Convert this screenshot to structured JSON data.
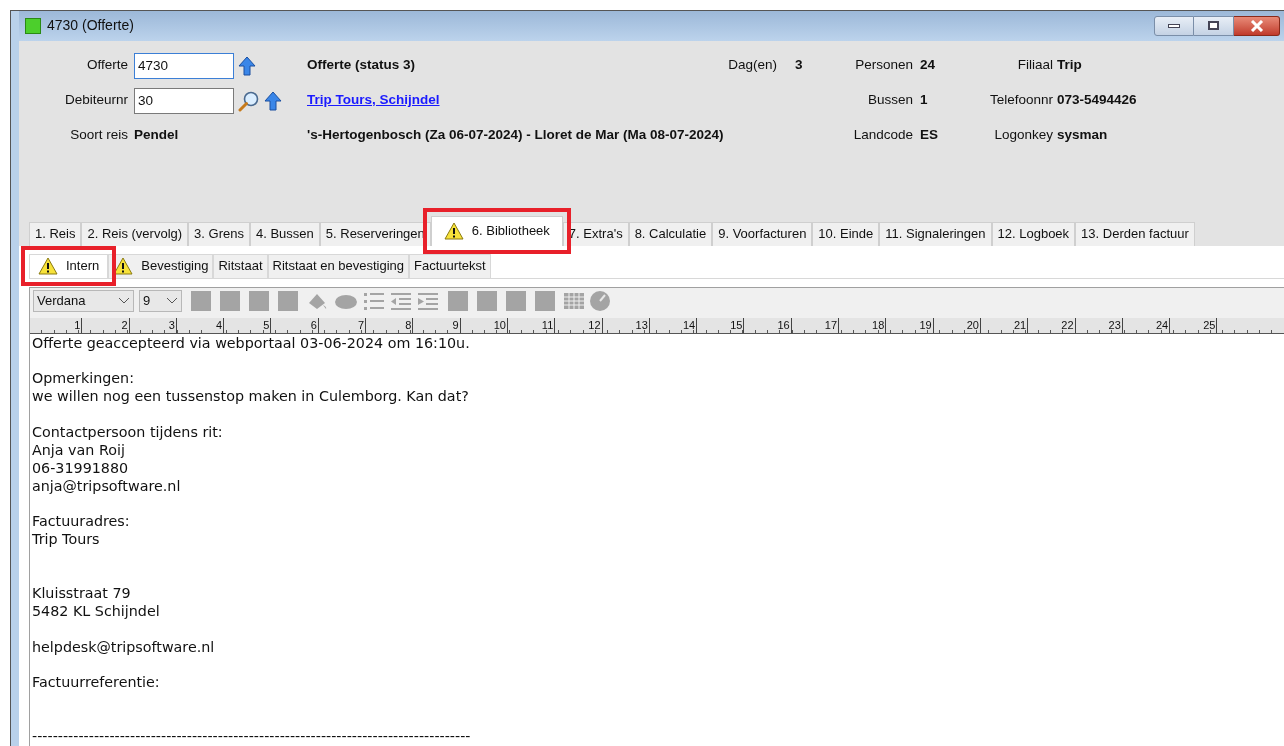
{
  "window": {
    "title": "4730 (Offerte)"
  },
  "header": {
    "offerte_label": "Offerte",
    "offerte_value": "4730",
    "debiteur_label": "Debiteurnr",
    "debiteur_value": "30",
    "status": "Offerte (status 3)",
    "customer_link": "Trip Tours, Schijndel",
    "soort_label": "Soort reis",
    "soort_value": "Pendel",
    "route": "'s-Hertogenbosch (Za 06-07-2024) - Lloret de Mar (Ma 08-07-2024)",
    "dagen_label": "Dag(en)",
    "dagen_value": "3",
    "personen_label": "Personen",
    "personen_value": "24",
    "bussen_label": "Bussen",
    "bussen_value": "1",
    "landcode_label": "Landcode",
    "landcode_value": "ES",
    "filiaal_label": "Filiaal",
    "filiaal_value": "Trip",
    "telefoon_label": "Telefoonnr",
    "telefoon_value": "073-5494426",
    "logonkey_label": "Logonkey",
    "logonkey_value": "sysman"
  },
  "tabs": [
    {
      "label": "1. Reis",
      "selected": false,
      "warning": false,
      "highlighted": false
    },
    {
      "label": "2. Reis (vervolg)",
      "selected": false,
      "warning": false,
      "highlighted": false
    },
    {
      "label": "3. Grens",
      "selected": false,
      "warning": false,
      "highlighted": false
    },
    {
      "label": "4. Bussen",
      "selected": false,
      "warning": false,
      "highlighted": false
    },
    {
      "label": "5. Reserveringen",
      "selected": false,
      "warning": false,
      "highlighted": false
    },
    {
      "label": "6. Bibliotheek",
      "selected": true,
      "warning": true,
      "highlighted": true
    },
    {
      "label": "7. Extra's",
      "selected": false,
      "warning": false,
      "highlighted": false
    },
    {
      "label": "8. Calculatie",
      "selected": false,
      "warning": false,
      "highlighted": false
    },
    {
      "label": "9. Voorfacturen",
      "selected": false,
      "warning": false,
      "highlighted": false
    },
    {
      "label": "10. Einde",
      "selected": false,
      "warning": false,
      "highlighted": false
    },
    {
      "label": "11. Signaleringen",
      "selected": false,
      "warning": false,
      "highlighted": false
    },
    {
      "label": "12. Logboek",
      "selected": false,
      "warning": false,
      "highlighted": false
    },
    {
      "label": "13. Derden factuur",
      "selected": false,
      "warning": false,
      "highlighted": false
    }
  ],
  "subtabs": [
    {
      "label": "Intern",
      "selected": true,
      "warning": true,
      "highlighted": true
    },
    {
      "label": "Bevestiging",
      "selected": false,
      "warning": true,
      "highlighted": false
    },
    {
      "label": "Ritstaat",
      "selected": false,
      "warning": false,
      "highlighted": false
    },
    {
      "label": "Ritstaat en bevestiging",
      "selected": false,
      "warning": false,
      "highlighted": false
    },
    {
      "label": "Factuurtekst",
      "selected": false,
      "warning": false,
      "highlighted": false
    }
  ],
  "toolbar": {
    "font": "Verdana",
    "size": "9"
  },
  "ruler_labels": [
    "1",
    "2",
    "3",
    "4",
    "5",
    "6",
    "7",
    "8",
    "9",
    "10",
    "11",
    "12",
    "13",
    "14",
    "15",
    "16",
    "17",
    "18",
    "19",
    "20",
    "21",
    "22",
    "23",
    "24",
    "25"
  ],
  "document_text": "Offerte geaccepteerd via webportaal 03-06-2024 om 16:10u.\n\nOpmerkingen:\nwe willen nog een tussenstop maken in Culemborg. Kan dat?\n\nContactpersoon tijdens rit:\nAnja van Roij\n06-31991880\nanja@tripsoftware.nl\n\nFactuuradres:\nTrip Tours\n\n\nKluisstraat 79\n5482 KL Schijndel\n\nhelpdesk@tripsoftware.nl\n\nFactuurreferentie:\n\n\n-------------------------------------------------------------------------------------"
}
